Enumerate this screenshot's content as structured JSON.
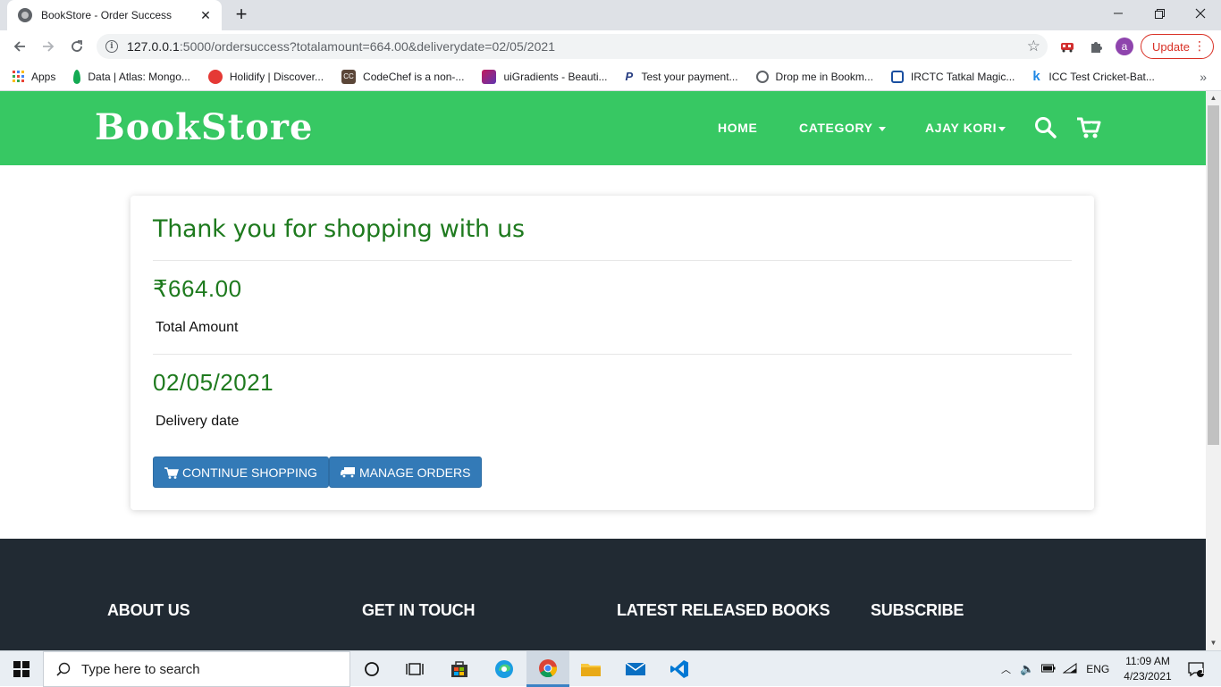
{
  "browser": {
    "tab_title": "BookStore - Order Success",
    "url_host": "127.0.0.1",
    "url_rest": ":5000/ordersuccess?totalamount=664.00&deliverydate=02/05/2021",
    "profile_initial": "a",
    "update_label": "Update",
    "bookmarks": [
      {
        "label": "Apps",
        "color": "#4285f4"
      },
      {
        "label": "Data | Atlas: Mongo...",
        "color": "#13aa52"
      },
      {
        "label": "Holidify | Discover...",
        "color": "#e53935"
      },
      {
        "label": "CodeChef is a non-...",
        "color": "#5b4638"
      },
      {
        "label": "uiGradients - Beauti...",
        "color": "#8e44ad"
      },
      {
        "label": "Test your payment...",
        "color": "#253b80"
      },
      {
        "label": "Drop me in Bookm...",
        "color": "#5f6368"
      },
      {
        "label": "IRCTC Tatkal Magic...",
        "color": "#1a4fa0"
      },
      {
        "label": "ICC Test Cricket-Bat...",
        "color": "#1e88e5"
      }
    ]
  },
  "navbar": {
    "brand": "BookStore",
    "home": "HOME",
    "category": "CATEGORY",
    "user": "AJAY KORI",
    "bg_color": "#37c863"
  },
  "order": {
    "heading": "Thank you for shopping with us",
    "amount": "₹664.00",
    "amount_label": "Total Amount",
    "delivery_date": "02/05/2021",
    "delivery_label": "Delivery date",
    "continue_label": "CONTINUE SHOPPING",
    "manage_label": "MANAGE ORDERS",
    "accent_color": "#1e7a1e",
    "button_color": "#337ab7"
  },
  "footer": {
    "headings": [
      "ABOUT US",
      "GET IN TOUCH",
      "LATEST RELEASED BOOKS",
      "SUBSCRIBE"
    ],
    "bg_color": "#212a33"
  },
  "taskbar": {
    "search_placeholder": "Type here to search",
    "language": "ENG",
    "time": "11:09 AM",
    "date": "4/23/2021",
    "notifications": "1"
  }
}
